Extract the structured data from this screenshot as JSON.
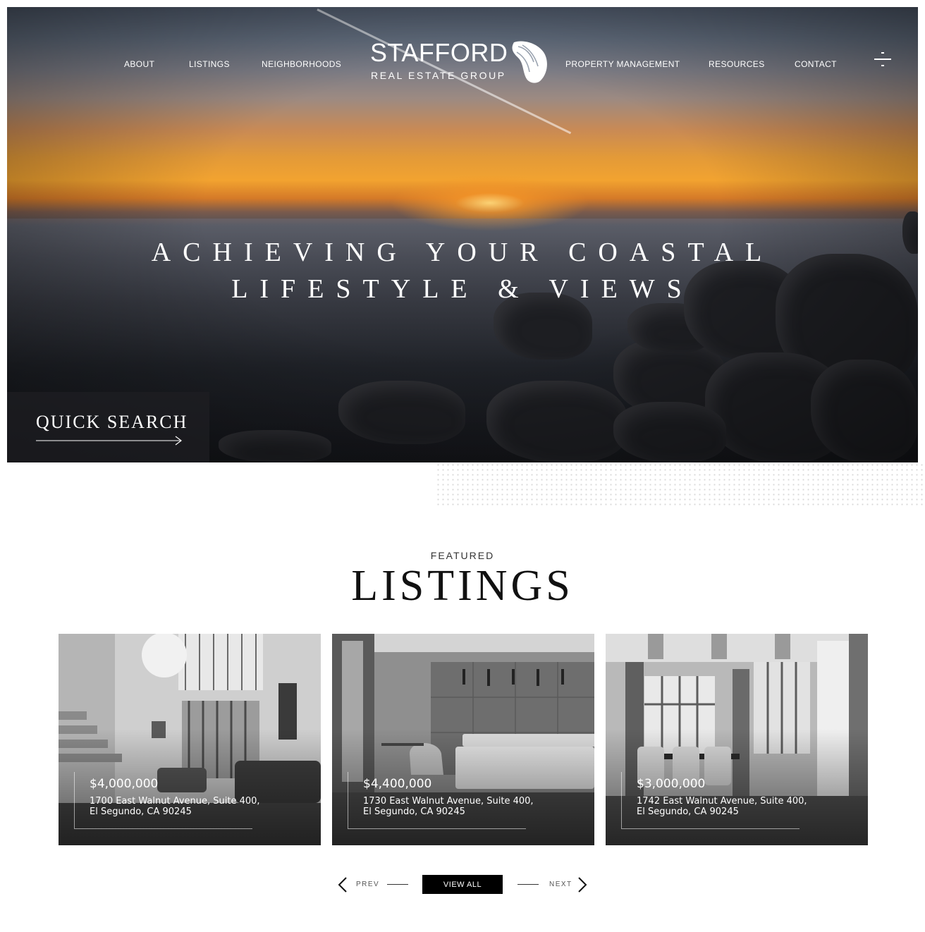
{
  "nav": {
    "left": [
      "ABOUT",
      "LISTINGS",
      "NEIGHBORHOODS"
    ],
    "right": [
      "PROPERTY MANAGEMENT",
      "RESOURCES",
      "CONTACT"
    ]
  },
  "brand": {
    "name": "STAFFORD",
    "tagline": "REAL ESTATE GROUP",
    "logo_icon": "shell-icon"
  },
  "hero": {
    "title_line1": "ACHIEVING YOUR COASTAL",
    "title_line2": "LIFESTYLE & VIEWS",
    "quick_search_label": "QUICK SEARCH"
  },
  "featured": {
    "kicker": "FEATURED",
    "title": "LISTINGS"
  },
  "listings": [
    {
      "price": "$4,000,000",
      "address_line1": "1700 East Walnut Avenue, Suite 400,",
      "address_line2": "El Segundo, CA 90245"
    },
    {
      "price": "$4,400,000",
      "address_line1": "1730 East Walnut Avenue, Suite 400,",
      "address_line2": "El Segundo, CA 90245"
    },
    {
      "price": "$3,000,000",
      "address_line1": "1742 East Walnut Avenue, Suite 400,",
      "address_line2": "El Segundo, CA 90245"
    }
  ],
  "pager": {
    "prev_label": "PREV",
    "view_all_label": "VIEW ALL",
    "next_label": "NEXT"
  },
  "colors": {
    "accent": "#000000",
    "text_on_image": "#ffffff"
  }
}
